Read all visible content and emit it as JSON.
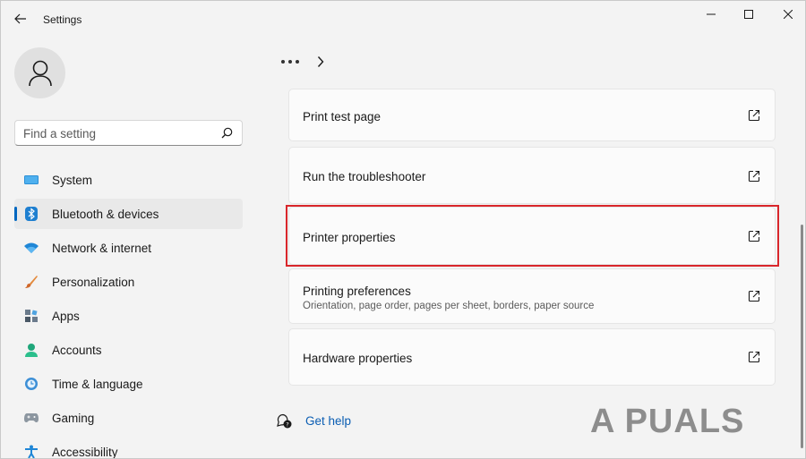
{
  "window": {
    "title": "Settings",
    "controls": [
      "minimize",
      "maximize",
      "close"
    ]
  },
  "sidebar": {
    "search": {
      "placeholder": "Find a setting"
    },
    "items": [
      {
        "label": "System",
        "icon": "system-icon",
        "selected": false
      },
      {
        "label": "Bluetooth & devices",
        "icon": "bluetooth-icon",
        "selected": true
      },
      {
        "label": "Network & internet",
        "icon": "wifi-icon",
        "selected": false
      },
      {
        "label": "Personalization",
        "icon": "brush-icon",
        "selected": false
      },
      {
        "label": "Apps",
        "icon": "apps-icon",
        "selected": false
      },
      {
        "label": "Accounts",
        "icon": "accounts-icon",
        "selected": false
      },
      {
        "label": "Time & language",
        "icon": "clock-globe-icon",
        "selected": false
      },
      {
        "label": "Gaming",
        "icon": "gamepad-icon",
        "selected": false
      },
      {
        "label": "Accessibility",
        "icon": "accessibility-icon",
        "selected": false
      }
    ]
  },
  "content": {
    "cards": [
      {
        "title": "Print test page",
        "subtitle": ""
      },
      {
        "title": "Run the troubleshooter",
        "subtitle": ""
      },
      {
        "title": "Printer properties",
        "subtitle": "",
        "highlighted": true
      },
      {
        "title": "Printing preferences",
        "subtitle": "Orientation, page order, pages per sheet, borders, paper source"
      },
      {
        "title": "Hardware properties",
        "subtitle": ""
      }
    ],
    "get_help": "Get help"
  },
  "watermark": "A PUALS",
  "colors": {
    "accent": "#0067c0",
    "highlight_border": "#d9262b",
    "link": "#0a5db3"
  }
}
